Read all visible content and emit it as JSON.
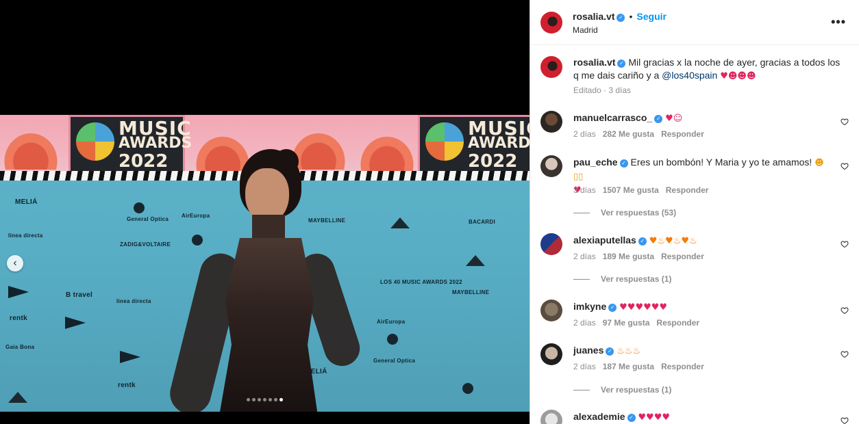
{
  "post": {
    "author": "rosalia.vt",
    "follow_label": "Seguir",
    "location": "Madrid",
    "more_label": "•••",
    "caption_text": "Mil gracias x la noche de ayer, gracias a todos los q me dais cariño y a ",
    "caption_mention": "@los40spain",
    "caption_emojis": "♥☻☻☻",
    "caption_meta": "Editado · 3 días"
  },
  "photo": {
    "banner_line1": "MUSIC",
    "banner_line2": "AWARDS",
    "banner_line3": "2022",
    "banner2_line1": "MUSIC",
    "banner2_line2": "AWARD",
    "banner2_line3": "2022",
    "sponsors": [
      "MELIÁ",
      "General Optica",
      "AirEuropa",
      "MAYBELLINE",
      "rentk",
      "B travel",
      "linea directa",
      "ZADIG&VOLTAIRE",
      "Gaia Bona",
      "LOS 40 MUSIC AWARDS 2022",
      "AirEuropa",
      "MAYBELLINE",
      "MELIÁ",
      "General Optica",
      "rentk",
      "linea directa",
      "BACARDI"
    ],
    "carousel_total": 7,
    "carousel_active": 7
  },
  "comments": [
    {
      "user": "manuelcarrasco_",
      "emojis": "♥☺",
      "time": "2 días",
      "likes": "282 Me gusta",
      "reply": "Responder",
      "view_replies": ""
    },
    {
      "user": "pau_eche",
      "text": "Eres un bombón! Y Maria y yo te amamos! ",
      "emojis": "☻▯▯",
      "emojis2": "♥",
      "time": "3 días",
      "likes": "1507 Me gusta",
      "reply": "Responder",
      "view_replies": "Ver respuestas (53)"
    },
    {
      "user": "alexiaputellas",
      "emojis": "♥♨♥♨♥♨",
      "time": "2 días",
      "likes": "189 Me gusta",
      "reply": "Responder",
      "view_replies": "Ver respuestas (1)"
    },
    {
      "user": "imkyne",
      "emojis": "♥♥♥♥♥♥",
      "time": "2 días",
      "likes": "97 Me gusta",
      "reply": "Responder",
      "view_replies": ""
    },
    {
      "user": "juanes",
      "emojis": "♨♨♨",
      "time": "2 días",
      "likes": "187 Me gusta",
      "reply": "Responder",
      "view_replies": "Ver respuestas (1)"
    },
    {
      "user": "alexademie",
      "emojis": "♥♥♥♥",
      "time": "",
      "likes": "",
      "reply": "",
      "view_replies": ""
    }
  ],
  "colors": {
    "accent": "#0095f6",
    "verified": "#3897f0",
    "muted": "#8e8e8e",
    "heart": "#e0245e"
  },
  "icons": {
    "verified": "verified-badge-icon",
    "like": "heart-outline-icon",
    "more": "more-horizontal-icon",
    "prev": "chevron-left-icon"
  }
}
